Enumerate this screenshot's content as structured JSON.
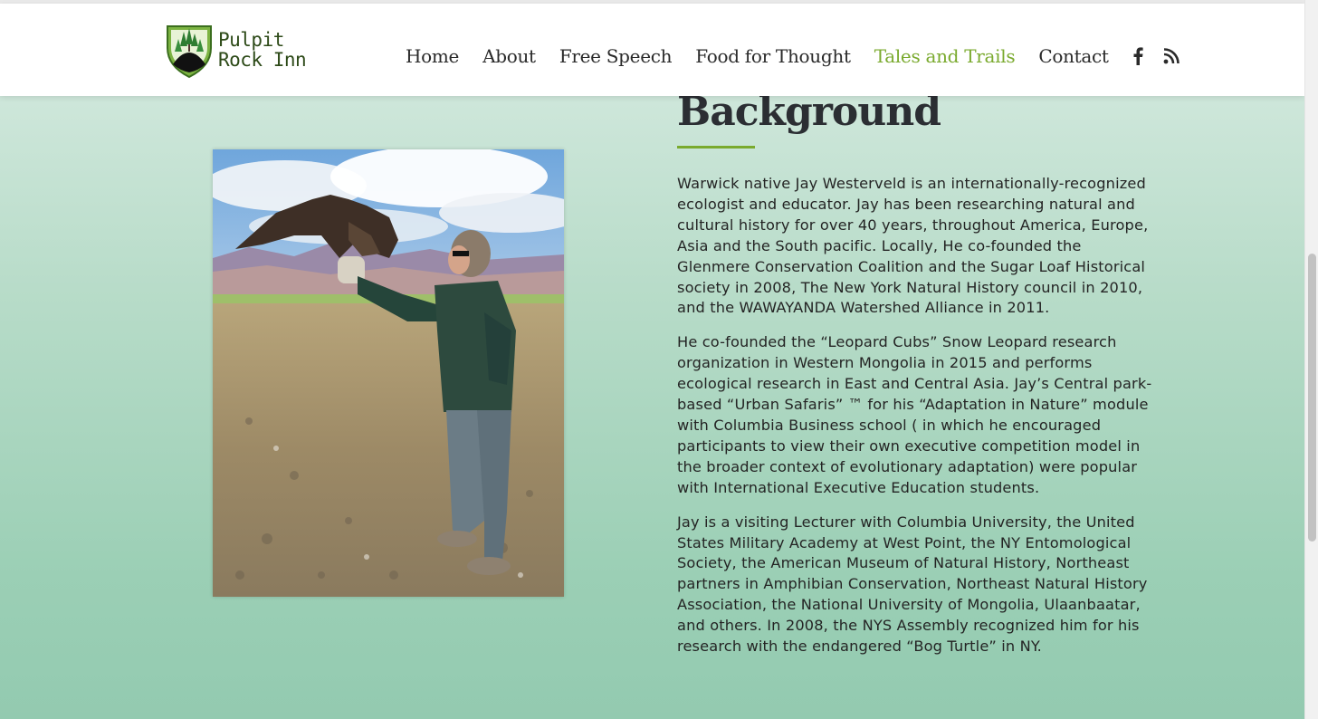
{
  "site": {
    "logo_line1": "Pulpit",
    "logo_line2": "Rock Inn"
  },
  "nav": {
    "items": [
      {
        "label": "Home",
        "active": false
      },
      {
        "label": "About",
        "active": false
      },
      {
        "label": "Free Speech",
        "active": false
      },
      {
        "label": "Food for Thought",
        "active": false
      },
      {
        "label": "Tales and Trails",
        "active": true
      },
      {
        "label": "Contact",
        "active": false
      }
    ],
    "icons": [
      "facebook-icon",
      "rss-icon"
    ],
    "active_color": "#7aaa2e"
  },
  "section": {
    "title": "Background",
    "paragraphs": [
      "Warwick native Jay Westerveld is an internationally-recognized ecologist and educator. Jay has been researching natural and cultural history for over 40 years, throughout America, Europe, Asia and the South pacific. Locally, He co-founded the Glenmere Conservation Coalition and the Sugar Loaf Historical society in 2008, The New York Natural History council in 2010, and the WAWAYANDA Watershed Alliance in 2011.",
      "He co-founded the “Leopard Cubs” Snow Leopard research organization in Western Mongolia in 2015 and performs ecological research in East and Central Asia. Jay’s Central park-based “Urban Safaris” ™ for his “Adaptation in Nature” module with Columbia Business school ( in which he encouraged participants to view their own executive competition model in the broader context of evolutionary adaptation) were popular with International Executive Education students.",
      "Jay is a visiting Lecturer with Columbia University,  the United States Military Academy at West Point, the NY Entomological Society, the American Museum of Natural History, Northeast partners in Amphibian Conservation, Northeast Natural History Association, the National University of Mongolia, Ulaanbaatar, and others. In 2008, the NYS Assembly recognized him for his research with the endangered “Bog Turtle” in NY."
    ]
  },
  "colors": {
    "accent_green": "#7aaa2e",
    "background_top": "#d9ece3",
    "background_bottom": "#93cab0"
  }
}
